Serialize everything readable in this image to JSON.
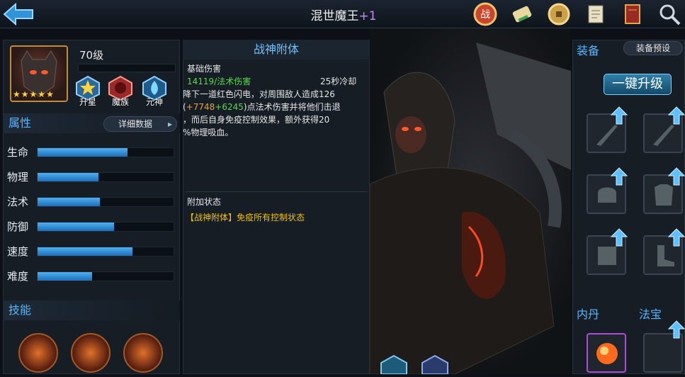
{
  "header": {
    "title": "混世魔王",
    "title_plus": "+1",
    "icons": [
      "battle-badge-icon",
      "scroll-icon",
      "coin-icon",
      "document-icon",
      "book-icon",
      "search-icon"
    ]
  },
  "hero": {
    "level": "70级",
    "stars": 5,
    "buttons": [
      "升星",
      "魔族",
      "元神"
    ]
  },
  "attributes": {
    "heading": "属性",
    "detail_button": "详细数据",
    "rows": [
      {
        "label": "生命",
        "fill": 0.66
      },
      {
        "label": "物理",
        "fill": 0.45
      },
      {
        "label": "法术",
        "fill": 0.46
      },
      {
        "label": "防御",
        "fill": 0.56
      },
      {
        "label": "速度",
        "fill": 0.7
      },
      {
        "label": "难度",
        "fill": 0.4
      }
    ]
  },
  "skills": {
    "heading": "技能",
    "count": 3
  },
  "skill_detail": {
    "title": "战神附体",
    "base_damage_label": "基础伤害",
    "damage_value": "14119/法术伤害",
    "cooldown": "25秒冷却",
    "desc_1": "降下一道红色闪电，对周围敌人造成126",
    "desc_bonus_a": "+7748",
    "desc_bonus_b": "+6245",
    "desc_2": "点法术伤害并将他们击退",
    "desc_3": "，而后自身免疫控制效果，额外获得20",
    "desc_4": "%物理吸血。",
    "extra_label": "附加状态",
    "extra_tag": "【战神附体】",
    "extra_text": "免疫所有控制状态"
  },
  "equipment": {
    "heading": "装备",
    "preset_button": "装备预设",
    "upgrade_button": "一键升级",
    "neidan_heading": "内丹",
    "fabao_heading": "法宝"
  },
  "colors": {
    "accent_blue": "#58b6ff",
    "highlight_green": "#5bd94e",
    "bonus_orange": "#f0a030",
    "state_yellow": "#f2c200"
  }
}
